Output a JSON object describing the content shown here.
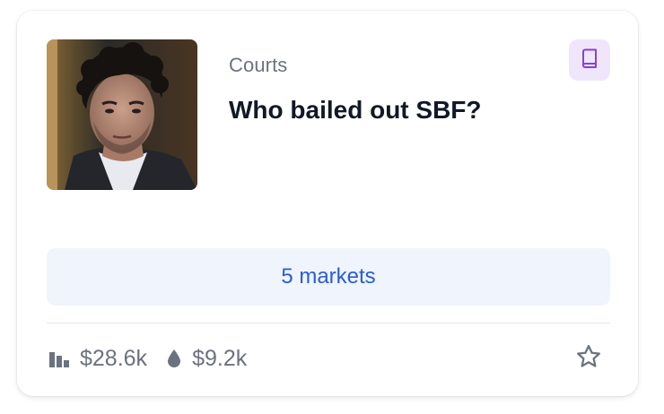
{
  "card": {
    "category": "Courts",
    "title": "Who bailed out SBF?",
    "thumbnail_alt": "Photo of SBF",
    "markets_label": "5 markets",
    "stats": {
      "volume": "$28.6k",
      "liquidity": "$9.2k"
    }
  },
  "icons": {
    "book": "book-icon",
    "volume": "bar-chart-icon",
    "liquidity": "droplet-icon",
    "favorite": "star-outline-icon"
  },
  "colors": {
    "accent_purple": "#8b3fd9",
    "markets_text": "#2a5cd6",
    "markets_bg": "#eff4fd",
    "muted_text": "#6b7280"
  }
}
